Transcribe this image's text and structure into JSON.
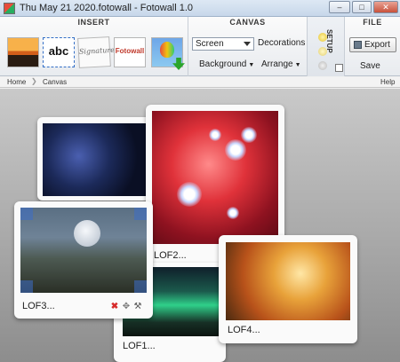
{
  "window": {
    "title": "Thu May 21 2020.fotowall - Fotowall 1.0",
    "minimize_label": "–",
    "restore_label": "□",
    "close_label": "✕"
  },
  "ribbon": {
    "insert": {
      "title": "INSERT",
      "items": [
        {
          "icon": "picture-icon"
        },
        {
          "label": "abc",
          "icon": "text-icon"
        },
        {
          "label": "Signature",
          "icon": "wordart-icon"
        },
        {
          "label": "Fotowall",
          "icon": "webcam-icon"
        },
        {
          "icon": "image-download-icon"
        }
      ]
    },
    "canvas": {
      "title": "CANVAS",
      "mode_select": "Screen",
      "decorations_label": "Decorations",
      "background_label": "Background",
      "arrange_label": "Arrange"
    },
    "setup": {
      "label": "SETUP"
    },
    "file": {
      "title": "FILE",
      "export_label": "Export",
      "save_label": "Save"
    }
  },
  "breadcrumb": {
    "items": [
      "Home",
      "Canvas"
    ],
    "help_label": "Help"
  },
  "canvas_items": [
    {
      "label": "LOF2...",
      "image": "red-nebula-photo"
    },
    {
      "label": "LOF3...",
      "image": "boy-and-moon-photo"
    },
    {
      "label": "LOF1...",
      "image": "aurora-photo"
    },
    {
      "label": "LOF4...",
      "image": "autumn-forest-photo"
    }
  ],
  "colors": {
    "accent": "#3570c7",
    "delete": "#d62b2b",
    "export_green": "#2aa52a"
  }
}
